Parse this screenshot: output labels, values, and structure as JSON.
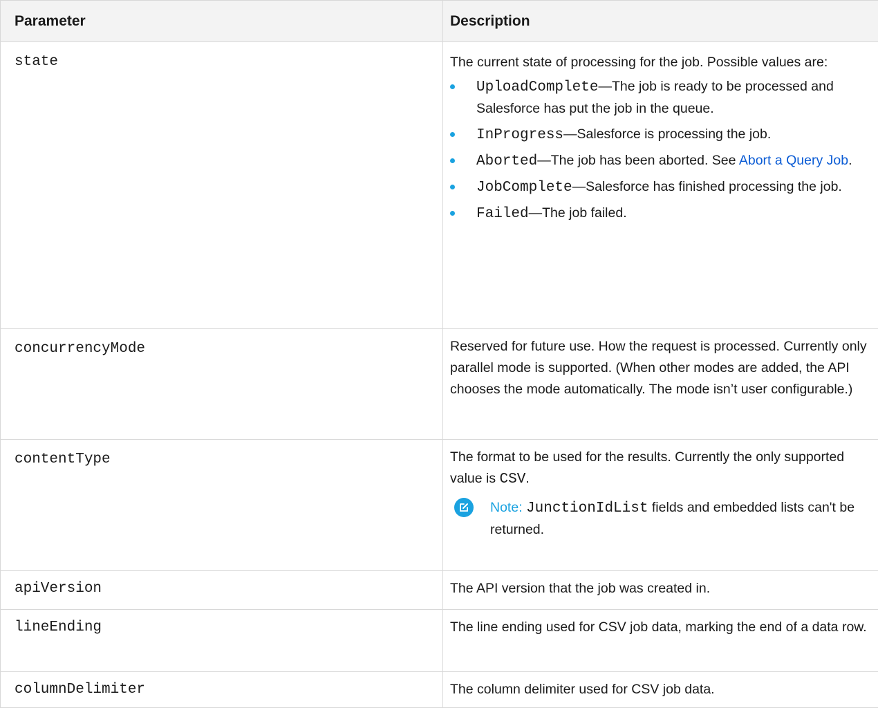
{
  "table": {
    "headers": {
      "parameter": "Parameter",
      "description": "Description"
    },
    "rows": [
      {
        "param": "state",
        "intro": "The current state of processing for the job. Possible values are:",
        "values": [
          {
            "code": "UploadComplete",
            "text": "—The job is ready to be processed and Salesforce has put the job in the queue."
          },
          {
            "code": "InProgress",
            "text": "—Salesforce is processing the job."
          },
          {
            "code": "Aborted",
            "text": "—The job has been aborted. See ",
            "link": "Abort a Query Job",
            "after": "."
          },
          {
            "code": "JobComplete",
            "text": "—Salesforce has finished processing the job."
          },
          {
            "code": "Failed",
            "text": "—The job failed."
          }
        ]
      },
      {
        "param": "concurrencyMode",
        "description": "Reserved for future use. How the request is processed. Currently only parallel mode is supported. (When other modes are added, the API chooses the mode automatically. The mode isn’t user configurable.)"
      },
      {
        "param": "contentType",
        "description_before": "The format to be used for the results. Currently the only supported value is ",
        "description_code": "CSV",
        "description_after": ".",
        "note": {
          "icon": "edit-note-icon",
          "label": "Note:",
          "code": "JunctionIdList",
          "text": " fields and embedded lists can't be returned."
        }
      },
      {
        "param": "apiVersion",
        "description": "The API version that the job was created in."
      },
      {
        "param": "lineEnding",
        "description": "The line ending used for CSV job data, marking the end of a data row."
      },
      {
        "param": "columnDelimiter",
        "description": "The column delimiter used for CSV job data."
      }
    ]
  },
  "colors": {
    "header_bg": "#f3f3f3",
    "border": "#d8d8d8",
    "accent": "#1aa2e0",
    "link": "#0b5cd5"
  }
}
